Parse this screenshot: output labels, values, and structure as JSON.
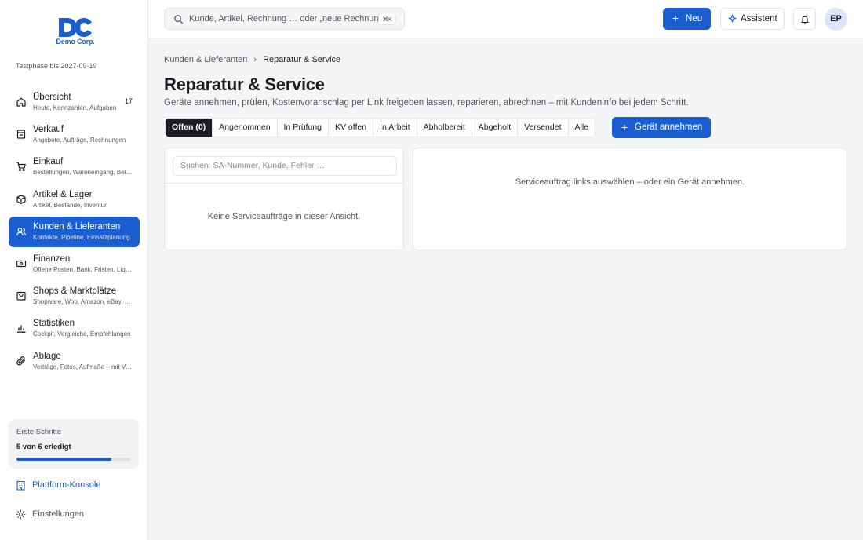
{
  "brand": {
    "name": "Demo Corp.",
    "trial": "Testphase bis 2027-09-19",
    "accent": "#1a5fd1"
  },
  "sidebar": {
    "items": [
      {
        "title": "Übersicht",
        "sub": "Heute, Kennzahlen, Aufgaben",
        "badge": "17",
        "icon": "home-icon"
      },
      {
        "title": "Verkauf",
        "sub": "Angebote, Aufträge, Rechnungen",
        "icon": "receipt-icon"
      },
      {
        "title": "Einkauf",
        "sub": "Bestellungen, Wareneingang, Belege",
        "icon": "cart-icon"
      },
      {
        "title": "Artikel & Lager",
        "sub": "Artikel, Bestände, Inventur",
        "icon": "box-icon"
      },
      {
        "title": "Kunden & Lieferanten",
        "sub": "Kontakte, Pipeline, Einsatzplanung",
        "icon": "users-icon",
        "active": true
      },
      {
        "title": "Finanzen",
        "sub": "Offene Posten, Bank, Fristen, Liquidität",
        "icon": "cash-icon"
      },
      {
        "title": "Shops & Marktplätze",
        "sub": "Shopware, Woo, Amazon, eBay, Etsy",
        "icon": "shop-icon"
      },
      {
        "title": "Statistiken",
        "sub": "Cockpit, Vergleiche, Empfehlungen",
        "icon": "chart-icon"
      },
      {
        "title": "Ablage",
        "sub": "Verträge, Fotos, Aufmaße – mit Vorschau",
        "icon": "paperclip-icon"
      }
    ],
    "progress": {
      "label": "Erste Schritte",
      "value": "5 von 6 erledigt",
      "fraction": 0.83
    },
    "console_label": "Plattform-Konsole",
    "settings_label": "Einstellungen"
  },
  "topbar": {
    "search_placeholder": "Kunde, Artikel, Rechnung … oder „neue Rechnung“",
    "search_shortcut": "⌘K",
    "new_label": "Neu",
    "assistant_label": "Assistent",
    "avatar_initials": "EP"
  },
  "main": {
    "breadcrumb": [
      "Kunden & Lieferanten",
      "Reparatur & Service"
    ],
    "title": "Reparatur & Service",
    "subtitle": "Geräte annehmen, prüfen, Kostenvoranschlag per Link freigeben lassen, reparieren, abrechnen – mit Kundeninfo bei jedem Schritt.",
    "tabs": [
      "Offen (0)",
      "Angenommen",
      "In Prüfung",
      "KV offen",
      "In Arbeit",
      "Abholbereit",
      "Abgeholt",
      "Versendet",
      "Alle"
    ],
    "receive_label": "Gerät annehmen",
    "list_search_placeholder": "Suchen: SA-Nummer, Kunde, Fehler …",
    "empty_list": "Keine Serviceaufträge in dieser Ansicht.",
    "empty_detail": "Serviceauftrag links auswählen – oder ein Gerät annehmen."
  }
}
